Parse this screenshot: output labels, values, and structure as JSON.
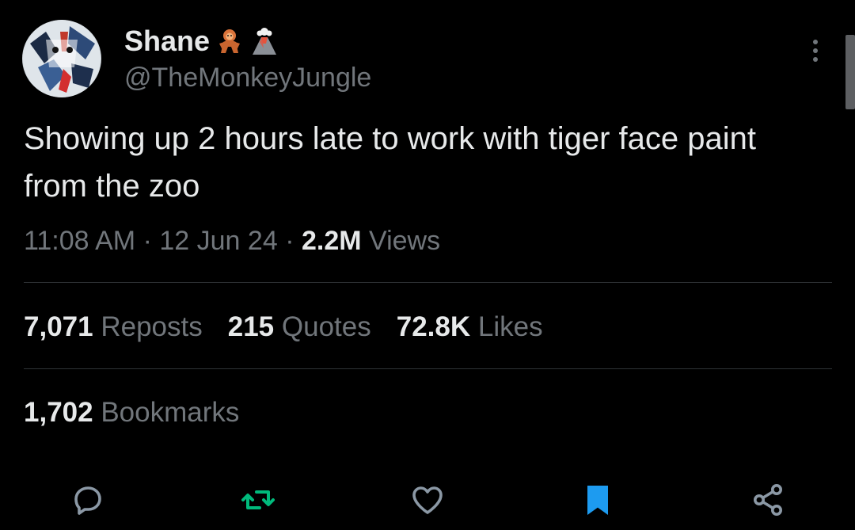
{
  "author": {
    "display_name": "Shane",
    "handle": "@TheMonkeyJungle",
    "name_emojis": [
      "orangutan-emoji",
      "volcano-emoji"
    ]
  },
  "tweet": {
    "text": "Showing up 2 hours late to work with tiger face paint from the zoo",
    "time": "11:08 AM",
    "separator": "·",
    "date": "12 Jun 24",
    "views_count": "2.2M",
    "views_label": "Views"
  },
  "stats": {
    "reposts_count": "7,071",
    "reposts_label": "Reposts",
    "quotes_count": "215",
    "quotes_label": "Quotes",
    "likes_count": "72.8K",
    "likes_label": "Likes",
    "bookmarks_count": "1,702",
    "bookmarks_label": "Bookmarks"
  },
  "actions": {
    "reply_icon": "reply-icon",
    "repost_icon": "repost-icon",
    "like_icon": "heart-icon",
    "bookmark_icon": "bookmark-icon",
    "share_icon": "share-icon"
  },
  "colors": {
    "background": "#000000",
    "text_primary": "#e7e9ea",
    "text_secondary": "#71767b",
    "divider": "#2f3336",
    "repost_active": "#00ba7c",
    "bookmark_active": "#1d9bf0"
  }
}
